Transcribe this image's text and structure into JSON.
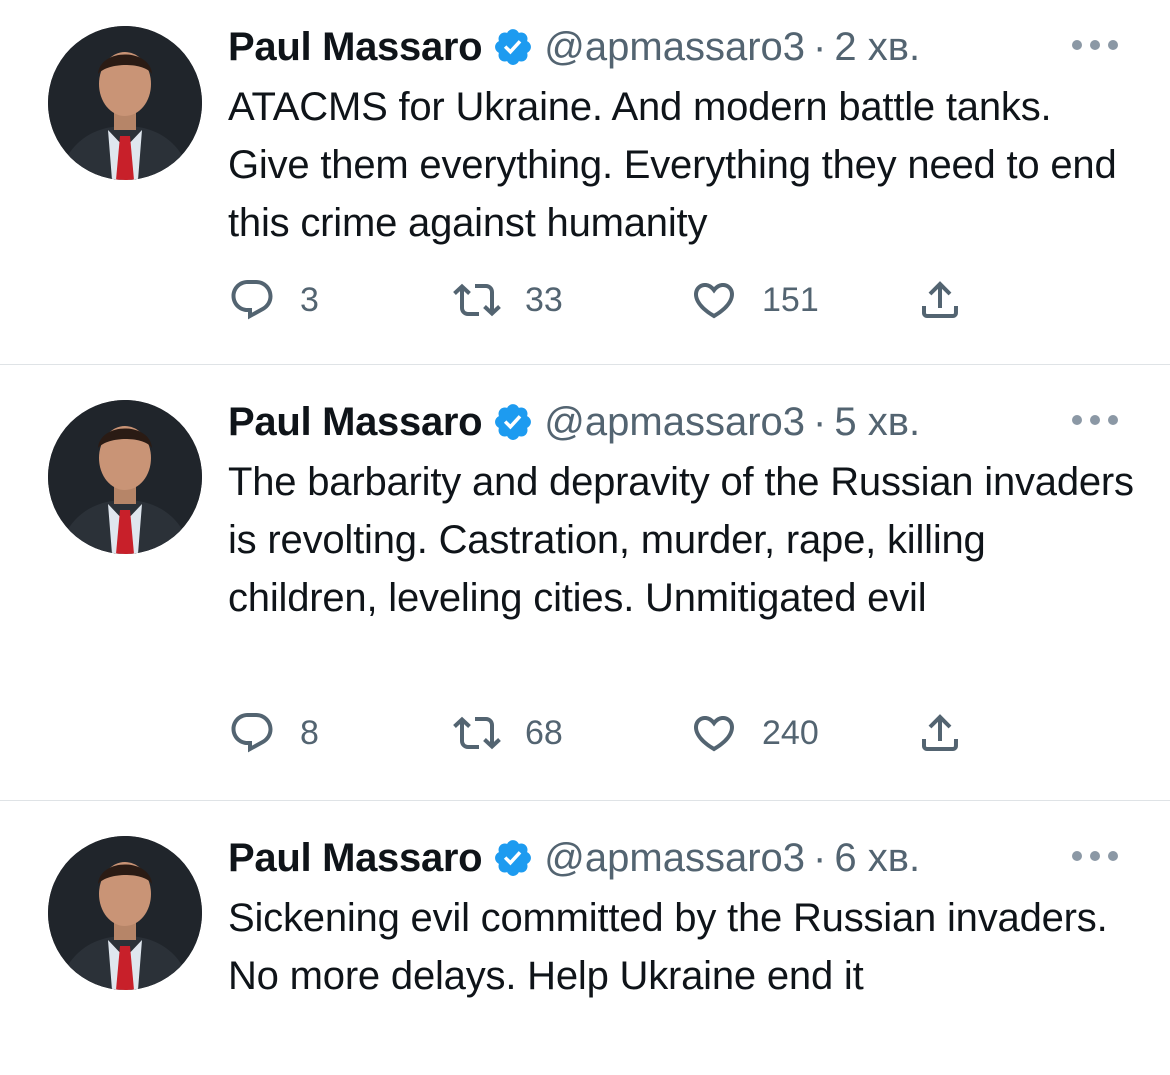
{
  "tweets": [
    {
      "name": "Paul Massaro",
      "handle": "@apmassaro3",
      "separator": "·",
      "time": "2 хв.",
      "text": "ATACMS for Ukraine. And modern battle tanks. Give them everything. Everything they need to end this crime against humanity",
      "replies": "3",
      "retweets": "33",
      "likes": "151"
    },
    {
      "name": "Paul Massaro",
      "handle": "@apmassaro3",
      "separator": "·",
      "time": "5 хв.",
      "text": "The barbarity and depravity of the Russian invaders is revolting. Castration, murder, rape, killing children, leveling cities. Unmitigated evil",
      "replies": "8",
      "retweets": "68",
      "likes": "240"
    },
    {
      "name": "Paul Massaro",
      "handle": "@apmassaro3",
      "separator": "·",
      "time": "6 хв.",
      "text": "Sickening evil committed by the Russian invaders. No more delays. Help Ukraine end it"
    }
  ],
  "icons": {
    "verified": "verified-badge-icon",
    "more": "more-options-icon",
    "reply": "reply-icon",
    "retweet": "retweet-icon",
    "like": "heart-icon",
    "share": "share-icon"
  },
  "colors": {
    "verified_blue": "#1d9bf0",
    "secondary_text": "#536471",
    "primary_text": "#0f1419",
    "divider": "#dfe3e6"
  }
}
